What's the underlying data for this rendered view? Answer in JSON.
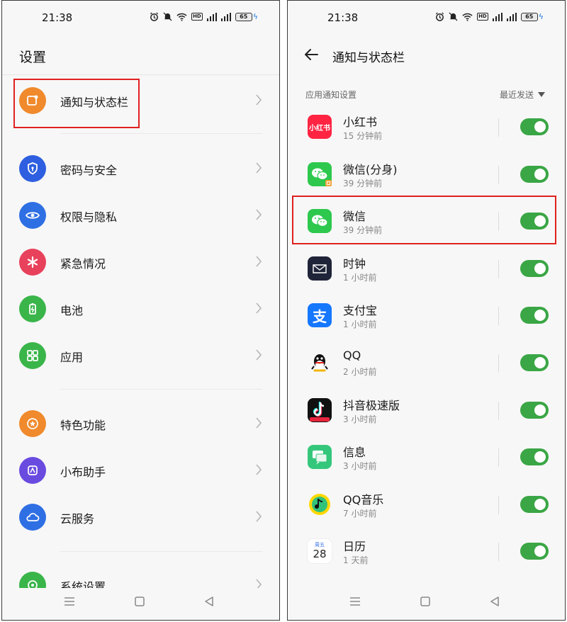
{
  "status": {
    "time": "21:38",
    "battery": "65"
  },
  "left": {
    "title": "设置",
    "items": [
      {
        "label": "通知与状态栏",
        "color": "#f08a2c",
        "icon": "notification-icon"
      },
      {
        "label": "密码与安全",
        "color": "#2e5fe0",
        "icon": "shield-icon"
      },
      {
        "label": "权限与隐私",
        "color": "#2f6fe4",
        "icon": "eye-icon"
      },
      {
        "label": "紧急情况",
        "color": "#e8415b",
        "icon": "asterisk-icon"
      },
      {
        "label": "电池",
        "color": "#3ab54a",
        "icon": "battery-icon"
      },
      {
        "label": "应用",
        "color": "#3ab54a",
        "icon": "grid-icon"
      },
      {
        "label": "特色功能",
        "color": "#f08a2c",
        "icon": "star-icon"
      },
      {
        "label": "小布助手",
        "color": "#6a4be0",
        "icon": "assistant-icon"
      },
      {
        "label": "云服务",
        "color": "#2f6fe4",
        "icon": "cloud-icon"
      },
      {
        "label": "系统设置",
        "color": "#3ab54a",
        "icon": "settings-icon"
      }
    ]
  },
  "right": {
    "title": "通知与状态栏",
    "section": "应用通知设置",
    "sort_label": "最近发送",
    "apps": [
      {
        "name": "小红书",
        "time": "15 分钟前",
        "icon": "xiaohongshu-icon",
        "on": true,
        "icon_text": "小红书"
      },
      {
        "name": "微信(分身)",
        "time": "39 分钟前",
        "icon": "wechat-clone-icon",
        "on": true
      },
      {
        "name": "微信",
        "time": "39 分钟前",
        "icon": "wechat-icon",
        "on": true
      },
      {
        "name": "时钟",
        "time": "1 小时前",
        "icon": "clock-icon",
        "on": true
      },
      {
        "name": "支付宝",
        "time": "1 小时前",
        "icon": "alipay-icon",
        "on": true,
        "icon_text": "支"
      },
      {
        "name": "QQ",
        "time": "2 小时前",
        "icon": "qq-icon",
        "on": true
      },
      {
        "name": "抖音极速版",
        "time": "3 小时前",
        "icon": "douyin-lite-icon",
        "on": true
      },
      {
        "name": "信息",
        "time": "3 小时前",
        "icon": "messages-icon",
        "on": true
      },
      {
        "name": "QQ音乐",
        "time": "7 小时前",
        "icon": "qq-music-icon",
        "on": true
      },
      {
        "name": "日历",
        "time": "1 天前",
        "icon": "calendar-icon",
        "on": true,
        "icon_day": "周五",
        "icon_date": "28"
      }
    ]
  },
  "colors": {
    "accent_green": "#3aa645",
    "highlight_red": "#e02020"
  }
}
